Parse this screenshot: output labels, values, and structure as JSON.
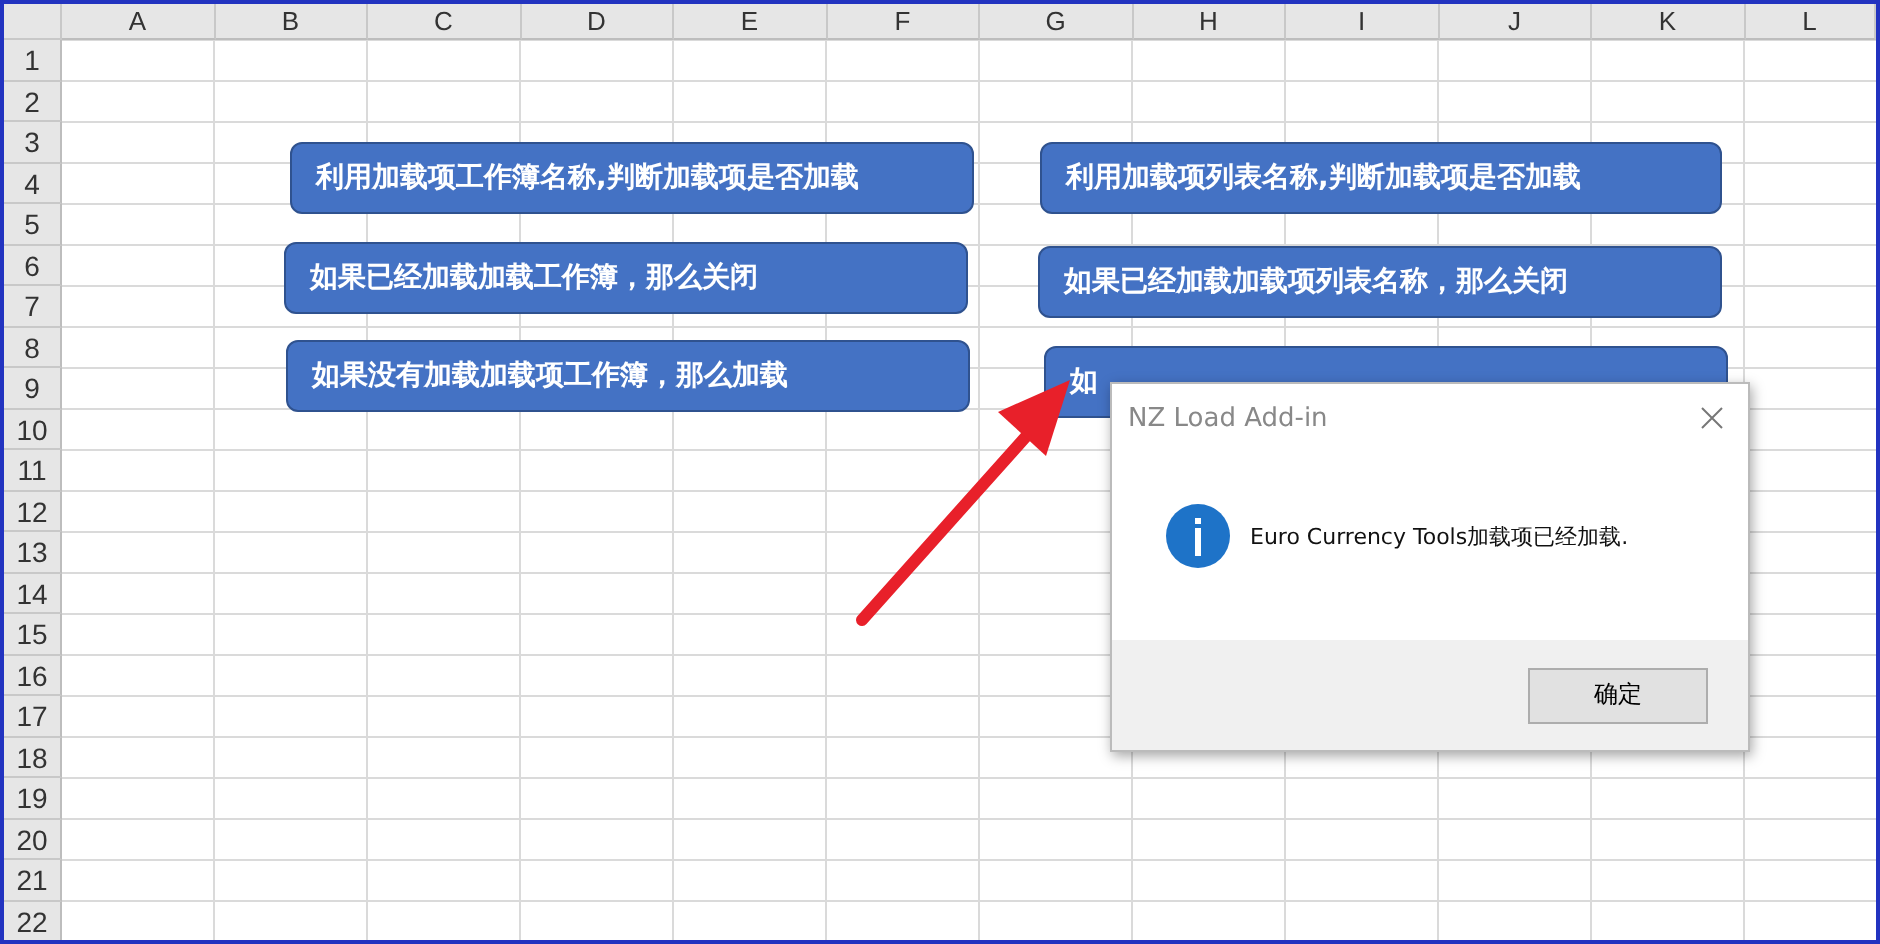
{
  "sheet": {
    "columns": [
      "A",
      "B",
      "C",
      "D",
      "E",
      "F",
      "G",
      "H",
      "I",
      "J",
      "K",
      "L"
    ],
    "rows": [
      "1",
      "2",
      "3",
      "4",
      "5",
      "6",
      "7",
      "8",
      "9",
      "10",
      "11",
      "12",
      "13",
      "14",
      "15",
      "16",
      "17",
      "18",
      "19",
      "20",
      "21",
      "22"
    ]
  },
  "shapes": [
    {
      "text": "利用加载项工作簿名称,判断加载项是否加载"
    },
    {
      "text": "如果已经加载加载工作簿，那么关闭"
    },
    {
      "text": "如果没有加载加载项工作簿，那么加载"
    },
    {
      "text": "利用加载项列表名称,判断加载项是否加载"
    },
    {
      "text": "如果已经加载加载项列表名称，那么关闭"
    },
    {
      "text": "如"
    }
  ],
  "dialog": {
    "title": "NZ Load Add-in",
    "message": "Euro Currency Tools加载项已经加载.",
    "buttons": [
      "确定"
    ]
  }
}
